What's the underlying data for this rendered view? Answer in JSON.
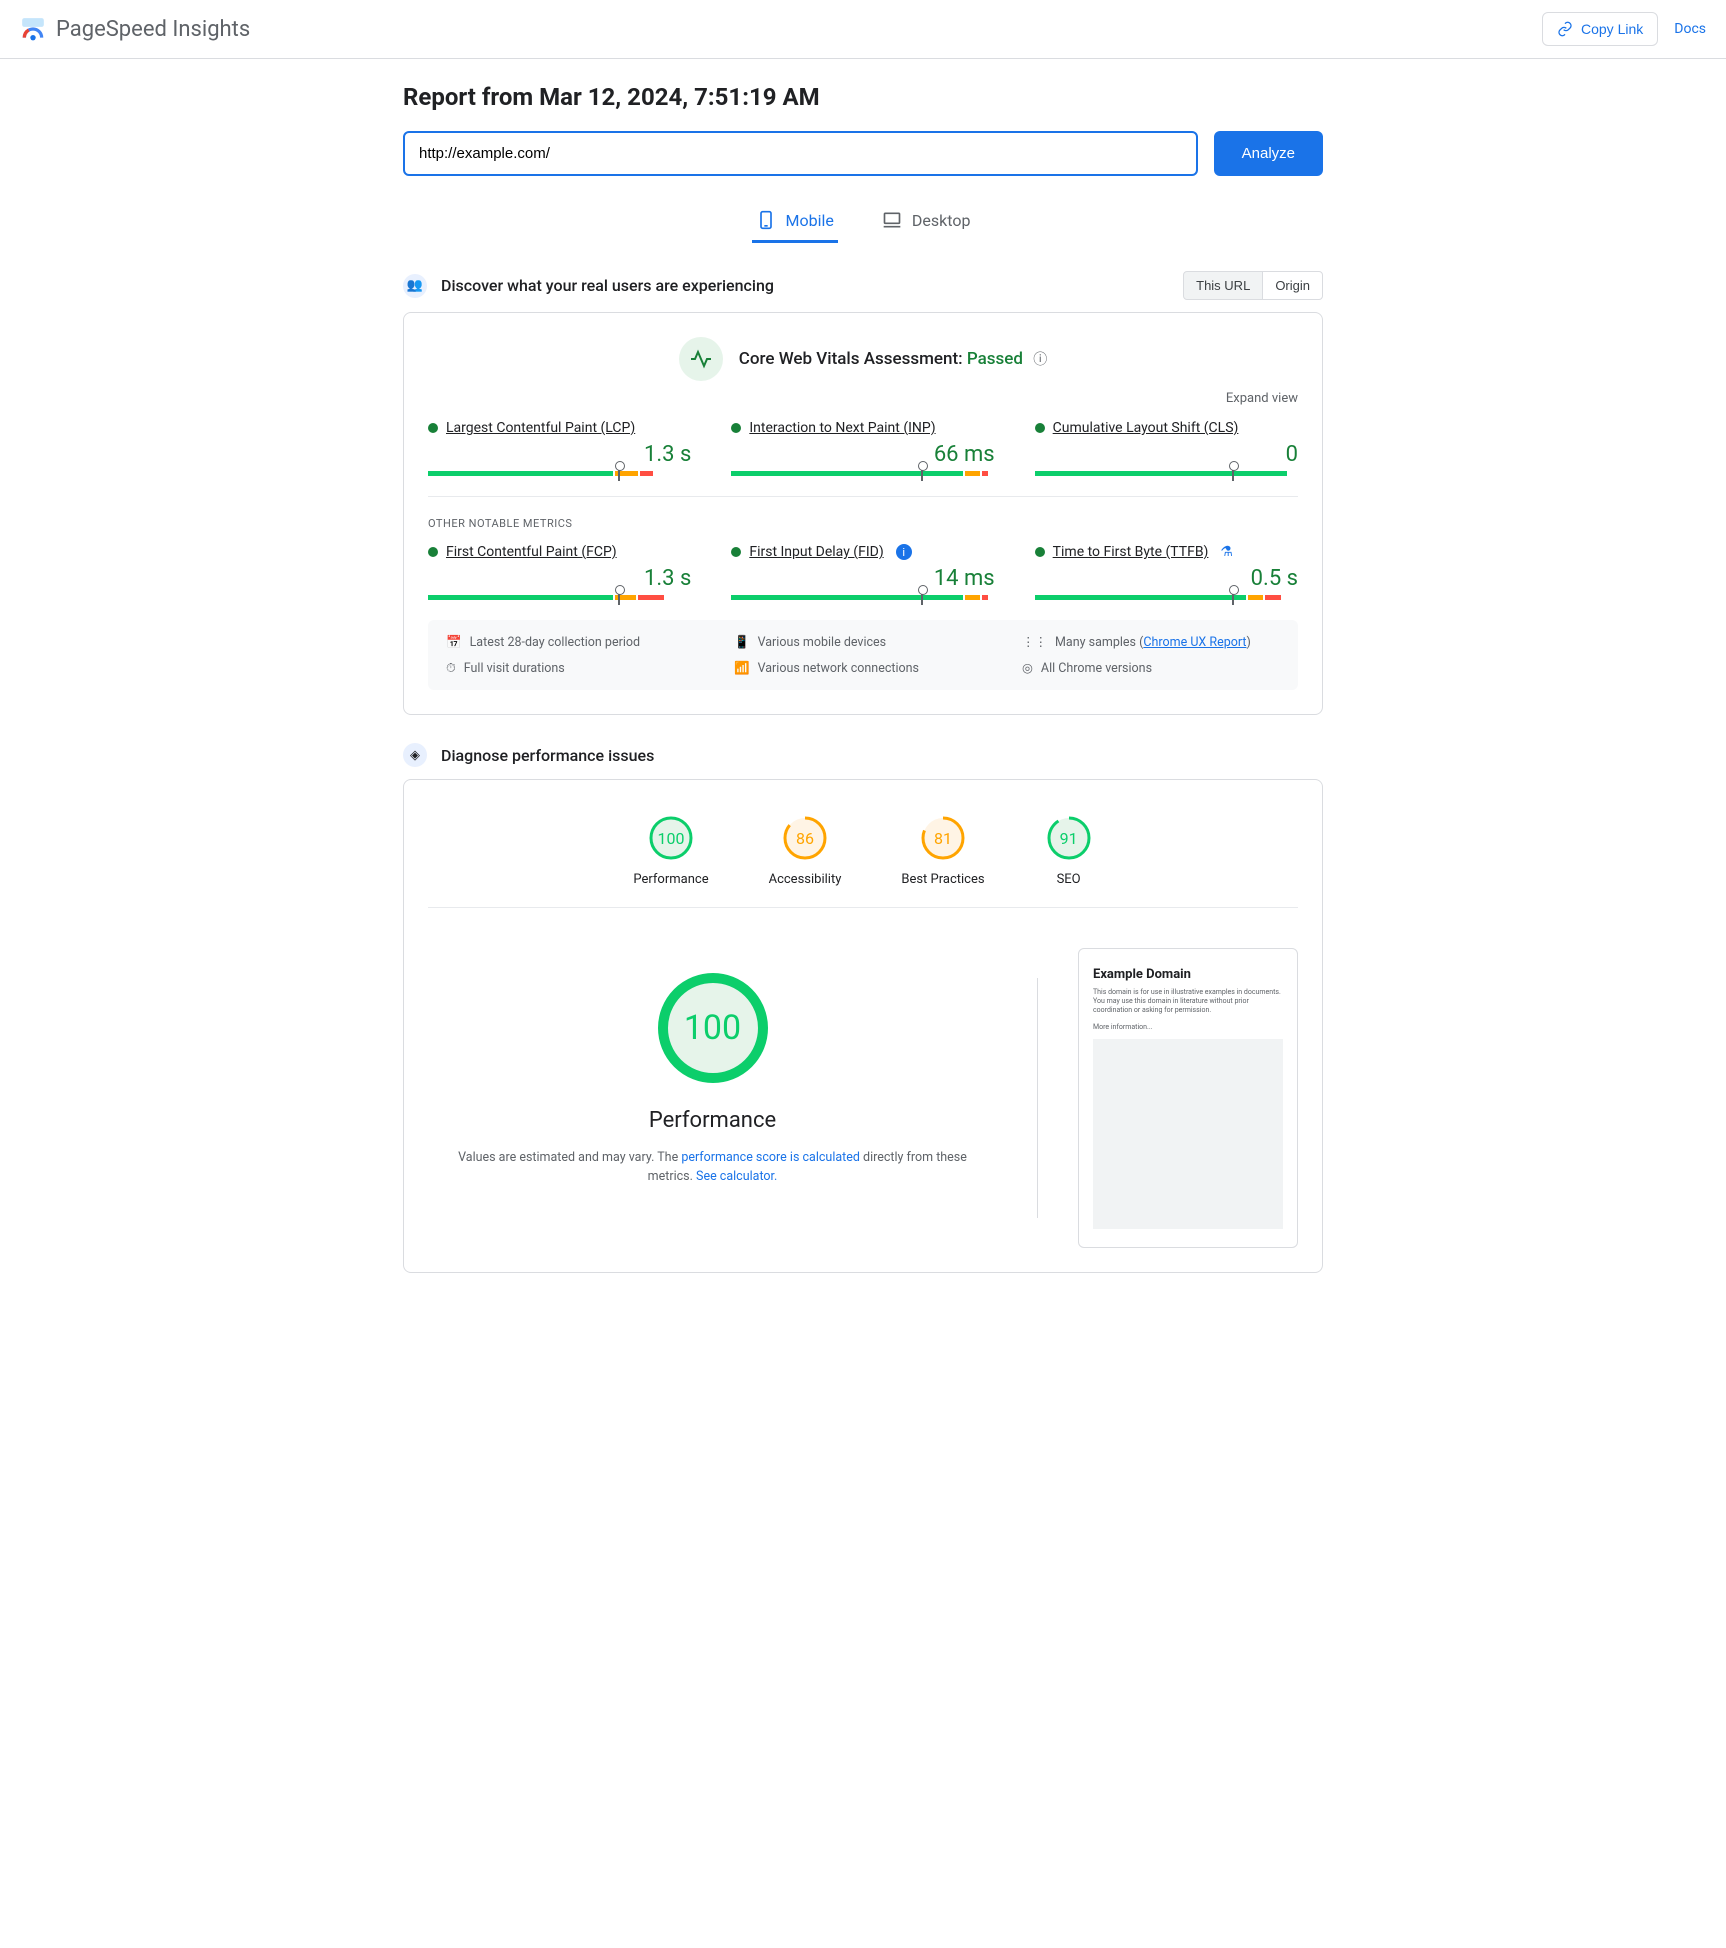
{
  "header": {
    "logo_text": "PageSpeed Insights",
    "copy_link": "Copy Link",
    "docs": "Docs"
  },
  "report": {
    "title": "Report from Mar 12, 2024, 7:51:19 AM",
    "url_value": "http://example.com/",
    "analyze": "Analyze"
  },
  "tabs": {
    "mobile": "Mobile",
    "desktop": "Desktop"
  },
  "discover": {
    "title": "Discover what your real users are experiencing",
    "this_url": "This URL",
    "origin": "Origin"
  },
  "assessment": {
    "label": "Core Web Vitals Assessment:",
    "status": "Passed",
    "expand": "Expand view"
  },
  "metrics": {
    "lcp": {
      "name": "Largest Contentful Paint (LCP)",
      "value": "1.3 s",
      "g": 72,
      "o": 9,
      "r": 5,
      "marker": 72
    },
    "inp": {
      "name": "Interaction to Next Paint (INP)",
      "value": "66 ms",
      "g": 90,
      "o": 6,
      "r": 2,
      "marker": 72
    },
    "cls": {
      "name": "Cumulative Layout Shift (CLS)",
      "value": "0",
      "g": 98,
      "o": 0,
      "r": 0,
      "marker": 75
    }
  },
  "other_label": "OTHER NOTABLE METRICS",
  "other_metrics": {
    "fcp": {
      "name": "First Contentful Paint (FCP)",
      "value": "1.3 s",
      "g": 72,
      "o": 8,
      "r": 10,
      "marker": 72
    },
    "fid": {
      "name": "First Input Delay (FID)",
      "value": "14 ms",
      "g": 90,
      "o": 6,
      "r": 2,
      "marker": 72
    },
    "ttfb": {
      "name": "Time to First Byte (TTFB)",
      "value": "0.5 s",
      "g": 82,
      "o": 6,
      "r": 6,
      "marker": 75
    }
  },
  "footer": {
    "collection": "Latest 28-day collection period",
    "devices": "Various mobile devices",
    "samples_pre": "Many samples (",
    "samples_link": "Chrome UX Report",
    "samples_post": ")",
    "durations": "Full visit durations",
    "network": "Various network connections",
    "versions": "All Chrome versions"
  },
  "diagnose": {
    "title": "Diagnose performance issues"
  },
  "scores": {
    "perf": {
      "value": "100",
      "label": "Performance",
      "color": "#0cce6b",
      "bg": "#e6f4ea",
      "pct": 100
    },
    "a11y": {
      "value": "86",
      "label": "Accessibility",
      "color": "#ffa400",
      "bg": "#fff4e5",
      "pct": 86
    },
    "bp": {
      "value": "81",
      "label": "Best Practices",
      "color": "#ffa400",
      "bg": "#fff4e5",
      "pct": 81
    },
    "seo": {
      "value": "91",
      "label": "SEO",
      "color": "#0cce6b",
      "bg": "#e6f4ea",
      "pct": 91
    }
  },
  "perf_big": {
    "value": "100",
    "title": "Performance",
    "note1": "Values are estimated and may vary. The ",
    "link1": "performance score is calculated",
    "note2": " directly from these metrics. ",
    "link2": "See calculator."
  },
  "preview": {
    "title": "Example Domain",
    "text": "This domain is for use in illustrative examples in documents. You may use this domain in literature without prior coordination or asking for permission.",
    "more": "More information..."
  }
}
